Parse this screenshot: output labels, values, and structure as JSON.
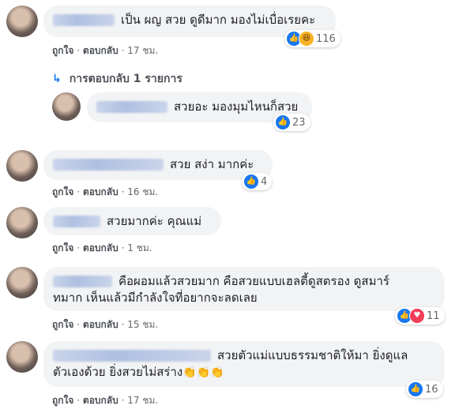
{
  "actions": {
    "like": "ถูกใจ",
    "reply": "ตอบกลับ",
    "separator": "·"
  },
  "comments": [
    {
      "text": "เป็น ผญ สวย ดูดีมาก มองไม่เบื่อเรยคะ",
      "reactions": [
        "like",
        "haha"
      ],
      "count": "116",
      "time": "17 ชม."
    },
    {
      "text": "สวยอะ มองมุมไหนก็สวย",
      "reactions": [
        "like"
      ],
      "count": "23",
      "time": ""
    },
    {
      "text": "สวย สง่า มากค่ะ",
      "reactions": [
        "like"
      ],
      "count": "4",
      "time": "16 ชม."
    },
    {
      "text": "สวยมากค่ะ คุณแม่",
      "reactions": [],
      "count": "",
      "time": "1 ชม."
    },
    {
      "text_line1": "คือผอมแล้วสวยมาก คือสวยแบบเฮลตี้ดูสตรอง ดูสมาร์",
      "text_line2": "ทมาก เห็นแล้วมีกำลังใจที่อยากจะลดเลย",
      "reactions": [
        "like",
        "love"
      ],
      "count": "11",
      "time": "15 ชม."
    },
    {
      "text_line1": "สวยตัวแม่แบบธรรมชาติให้มา ยิ่งดูแล",
      "text_line2": "ตัวเองด้วย ยิ่งสวยไม่สร่าง",
      "emojis": "👏👏👏",
      "reactions": [
        "like"
      ],
      "count": "16",
      "time": "17 ชม."
    }
  ],
  "replies_link": "การตอบกลับ 1 รายการ",
  "icons": {
    "like": "like-icon",
    "haha": "haha-icon",
    "love": "love-icon",
    "reply_arrow": "reply-arrow-icon"
  },
  "colors": {
    "bubble": "#f2f3f5",
    "like": "#1877f2",
    "link": "#4b4f56",
    "meta": "#65676b"
  }
}
